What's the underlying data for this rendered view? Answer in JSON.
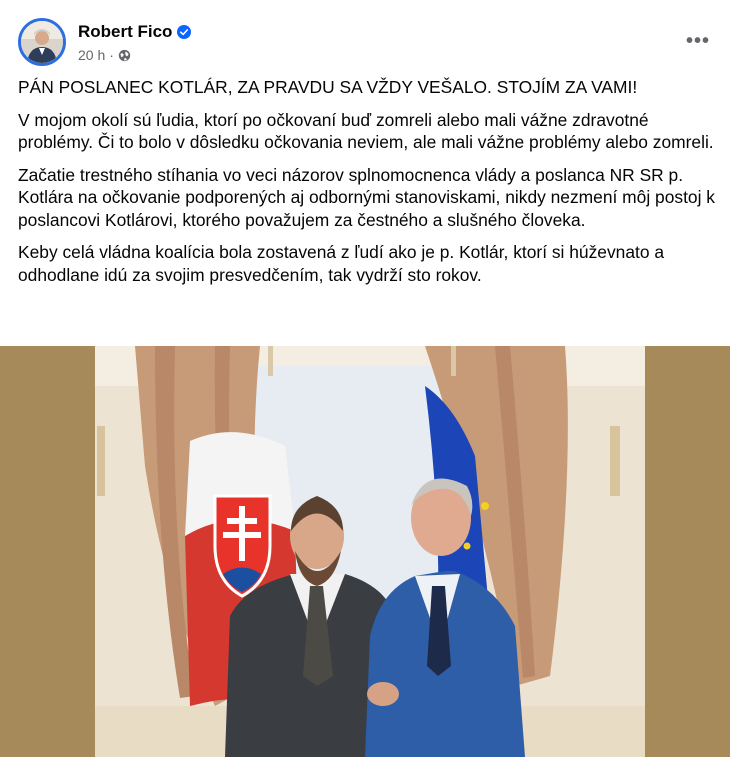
{
  "author": {
    "name": "Robert Fico",
    "verified": true,
    "time": "20 h",
    "separator": "·",
    "audience_icon": "globe-icon"
  },
  "menu_label": "•••",
  "paragraphs": [
    "PÁN POSLANEC KOTLÁR, ZA PRAVDU SA VŽDY VEŠALO. STOJÍM ZA VAMI!",
    "V mojom okolí sú ľudia, ktorí po očkovaní buď zomreli alebo mali vážne zdravotné problémy. Či to bolo v dôsledku očkovania neviem, ale mali vážne problémy alebo zomreli.",
    "Začatie trestného stíhania vo veci názorov splnomocnenca vlády a poslanca NR SR p. Kotlára na očkovanie podporených aj odbornými stanoviskami, nikdy nezmení môj postoj k poslancovi Kotlárovi, ktorého považujem za čestného a slušného človeka.",
    "Keby celá vládna koalícia bola zostavená z ľudí ako je p. Kotlár, ktorí si húževnato a odhodlane idú za svojim presvedčením, tak vydrží sto rokov."
  ],
  "colors": {
    "verified_badge": "#0866ff",
    "meta_text": "#65676b",
    "photo_letterbox": "#a78a5a",
    "avatar_ring": "#2d6fe0"
  }
}
